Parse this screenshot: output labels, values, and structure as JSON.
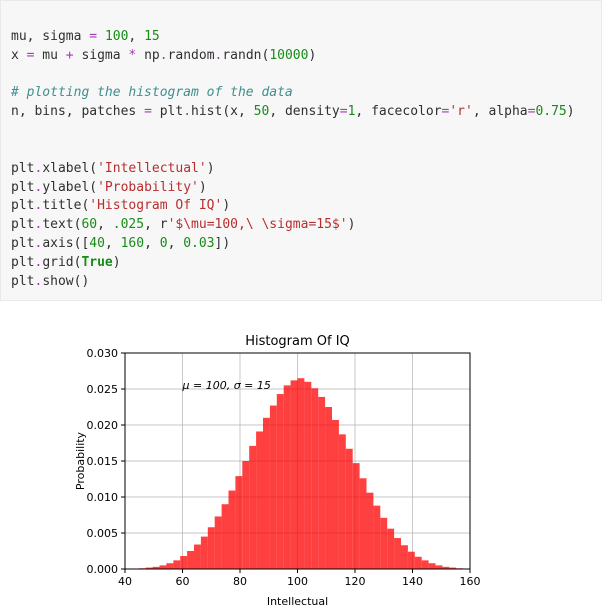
{
  "code": {
    "l01": {
      "a": "mu, sigma ",
      "op": "=",
      "b": " ",
      "n1": "100",
      "c": ", ",
      "n2": "15"
    },
    "l02": {
      "a": "x ",
      "op": "=",
      "b": " mu ",
      "op2": "+",
      "c": " sigma ",
      "op3": "*",
      "d": " np",
      "dot": ".",
      "e": "random",
      "dot2": ".",
      "f": "randn(",
      "n": "10000",
      "g": ")"
    },
    "l03": "",
    "l04": {
      "cmt": "# plotting the histogram of the data"
    },
    "l05": {
      "a": "n, bins, patches ",
      "op": "=",
      "b": " plt",
      "dot": ".",
      "c": "hist(x, ",
      "n1": "50",
      "d": ", density",
      "op2": "=",
      "n2": "1",
      "e": ", facecolor",
      "op3": "=",
      "s": "'r'",
      "f": ", alpha",
      "op4": "=",
      "n3": "0.75",
      "g": ")"
    },
    "l06": "",
    "l07": "",
    "l08": {
      "a": "plt",
      "dot": ".",
      "b": "xlabel(",
      "s": "'Intellectual'",
      "c": ")"
    },
    "l09": {
      "a": "plt",
      "dot": ".",
      "b": "ylabel(",
      "s": "'Probability'",
      "c": ")"
    },
    "l10": {
      "a": "plt",
      "dot": ".",
      "b": "title(",
      "s": "'Histogram Of IQ'",
      "c": ")"
    },
    "l11": {
      "a": "plt",
      "dot": ".",
      "b": "text(",
      "n1": "60",
      "c": ", ",
      "n2": ".025",
      "d": ", r",
      "s": "'$\\mu=100,\\ \\sigma=15$'",
      "e": ")"
    },
    "l12": {
      "a": "plt",
      "dot": ".",
      "b": "axis([",
      "n1": "40",
      "c": ", ",
      "n2": "160",
      "d": ", ",
      "n3": "0",
      "e": ", ",
      "n4": "0.03",
      "f": "])"
    },
    "l13": {
      "a": "plt",
      "dot": ".",
      "b": "grid(",
      "kw": "True",
      "c": ")"
    },
    "l14": {
      "a": "plt",
      "dot": ".",
      "b": "show()"
    }
  },
  "chart_data": {
    "type": "bar",
    "title": "Histogram Of IQ",
    "xlabel": "Intellectual",
    "ylabel": "Probability",
    "annotation": "μ = 100,  σ = 15",
    "annotation_xy": [
      60,
      0.025
    ],
    "xlim": [
      40,
      160
    ],
    "ylim": [
      0,
      0.03
    ],
    "xticks": [
      40,
      60,
      80,
      100,
      120,
      140,
      160
    ],
    "yticks": [
      0.0,
      0.005,
      0.01,
      0.015,
      0.02,
      0.025,
      0.03
    ],
    "facecolor": "#ff0000",
    "alpha": 0.75,
    "bins": 50,
    "bin_edges": [
      40.0,
      42.4,
      44.8,
      47.2,
      49.6,
      52.0,
      54.4,
      56.8,
      59.2,
      61.6,
      64.0,
      66.4,
      68.8,
      71.2,
      73.6,
      76.0,
      78.4,
      80.8,
      83.2,
      85.6,
      88.0,
      90.4,
      92.8,
      95.2,
      97.6,
      100.0,
      102.4,
      104.8,
      107.2,
      109.6,
      112.0,
      114.4,
      116.8,
      119.2,
      121.6,
      124.0,
      126.4,
      128.8,
      131.2,
      133.6,
      136.0,
      138.4,
      140.8,
      143.2,
      145.6,
      148.0,
      150.4,
      152.8,
      155.2,
      157.6,
      160.0
    ],
    "density_values": [
      2e-05,
      5e-05,
      0.0001,
      0.0002,
      0.0003,
      0.0005,
      0.0008,
      0.0012,
      0.0018,
      0.0025,
      0.0034,
      0.0045,
      0.0058,
      0.0073,
      0.009,
      0.0109,
      0.0129,
      0.015,
      0.0171,
      0.0191,
      0.021,
      0.0227,
      0.0243,
      0.0255,
      0.0262,
      0.0265,
      0.026,
      0.0251,
      0.0239,
      0.0225,
      0.0207,
      0.0187,
      0.0167,
      0.0147,
      0.0126,
      0.0106,
      0.0088,
      0.0071,
      0.0056,
      0.0043,
      0.0033,
      0.0024,
      0.0017,
      0.0012,
      0.0008,
      0.0005,
      0.0003,
      0.0002,
      0.0001,
      5e-05
    ]
  }
}
